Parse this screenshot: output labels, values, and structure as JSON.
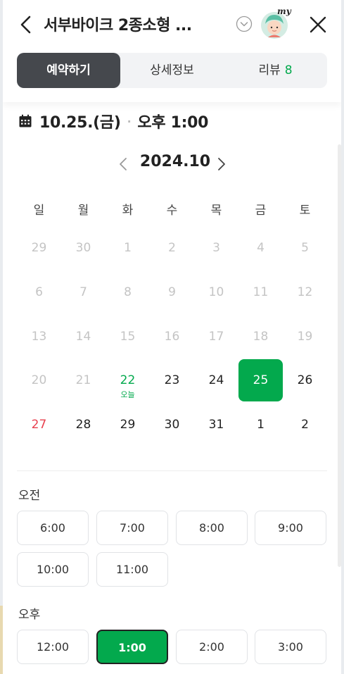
{
  "header": {
    "title": "서부바이크 2종소형 ...",
    "avatar_badge": "my",
    "icons": {
      "back": "chevron-left-icon",
      "dropdown": "chevron-down-circle-icon",
      "close": "close-icon"
    }
  },
  "tabs": [
    {
      "label": "예약하기",
      "active": true
    },
    {
      "label": "상세정보",
      "active": false
    },
    {
      "label": "리뷰",
      "count": "8",
      "active": false
    }
  ],
  "selected_summary": {
    "date": "10.25.(금)",
    "separator": "·",
    "time": "오후 1:00"
  },
  "calendar": {
    "month_label": "2024.10",
    "weekdays": [
      "일",
      "월",
      "화",
      "수",
      "목",
      "금",
      "토"
    ],
    "weeks": [
      [
        "29",
        "30",
        "1",
        "2",
        "3",
        "4",
        "5"
      ],
      [
        "6",
        "7",
        "8",
        "9",
        "10",
        "11",
        "12"
      ],
      [
        "13",
        "14",
        "15",
        "16",
        "17",
        "18",
        "19"
      ],
      [
        "20",
        "21",
        "22",
        "23",
        "24",
        "25",
        "26"
      ],
      [
        "27",
        "28",
        "29",
        "30",
        "31",
        "1",
        "2"
      ]
    ],
    "today_label": "오늘"
  },
  "times": {
    "am_label": "오전",
    "am_slots": [
      "6:00",
      "7:00",
      "8:00",
      "9:00",
      "10:00",
      "11:00"
    ],
    "pm_label": "오후",
    "pm_slots": [
      "12:00",
      "1:00",
      "2:00",
      "3:00"
    ],
    "selected": "1:00"
  },
  "colors": {
    "accent": "#03a94d",
    "tab_active": "#45484d",
    "sunday": "#e8414f",
    "muted": "#c4c4c4"
  }
}
